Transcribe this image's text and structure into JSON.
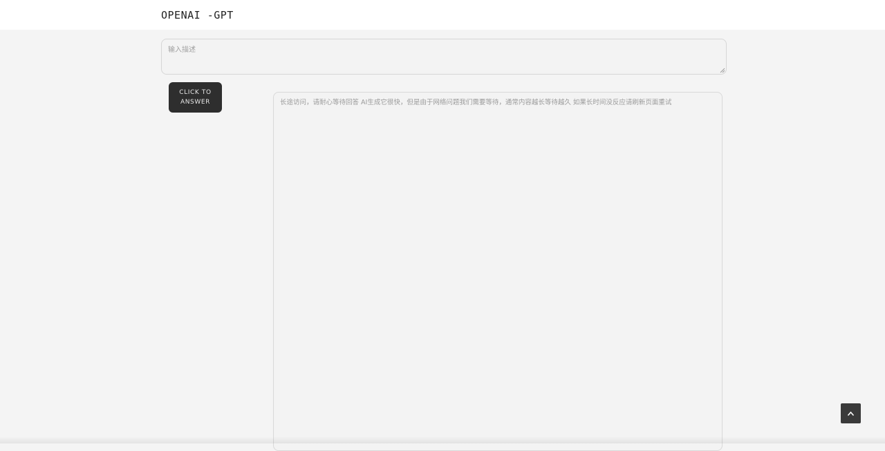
{
  "header": {
    "brand": "OPENAI -GPT"
  },
  "prompt": {
    "value": "",
    "placeholder": "输入描述"
  },
  "answer_button": {
    "line1": "CLICK TO",
    "line2": "ANSWER"
  },
  "answer": {
    "value": "",
    "placeholder": "长途访问，请耐心等待回答 AI生成它很快，但是由于网络问题我们需要等待，通常内容越长等待越久 如果长时间没反应请刷新页面重试"
  },
  "back_to_top": {
    "icon": "chevron-up-icon"
  }
}
